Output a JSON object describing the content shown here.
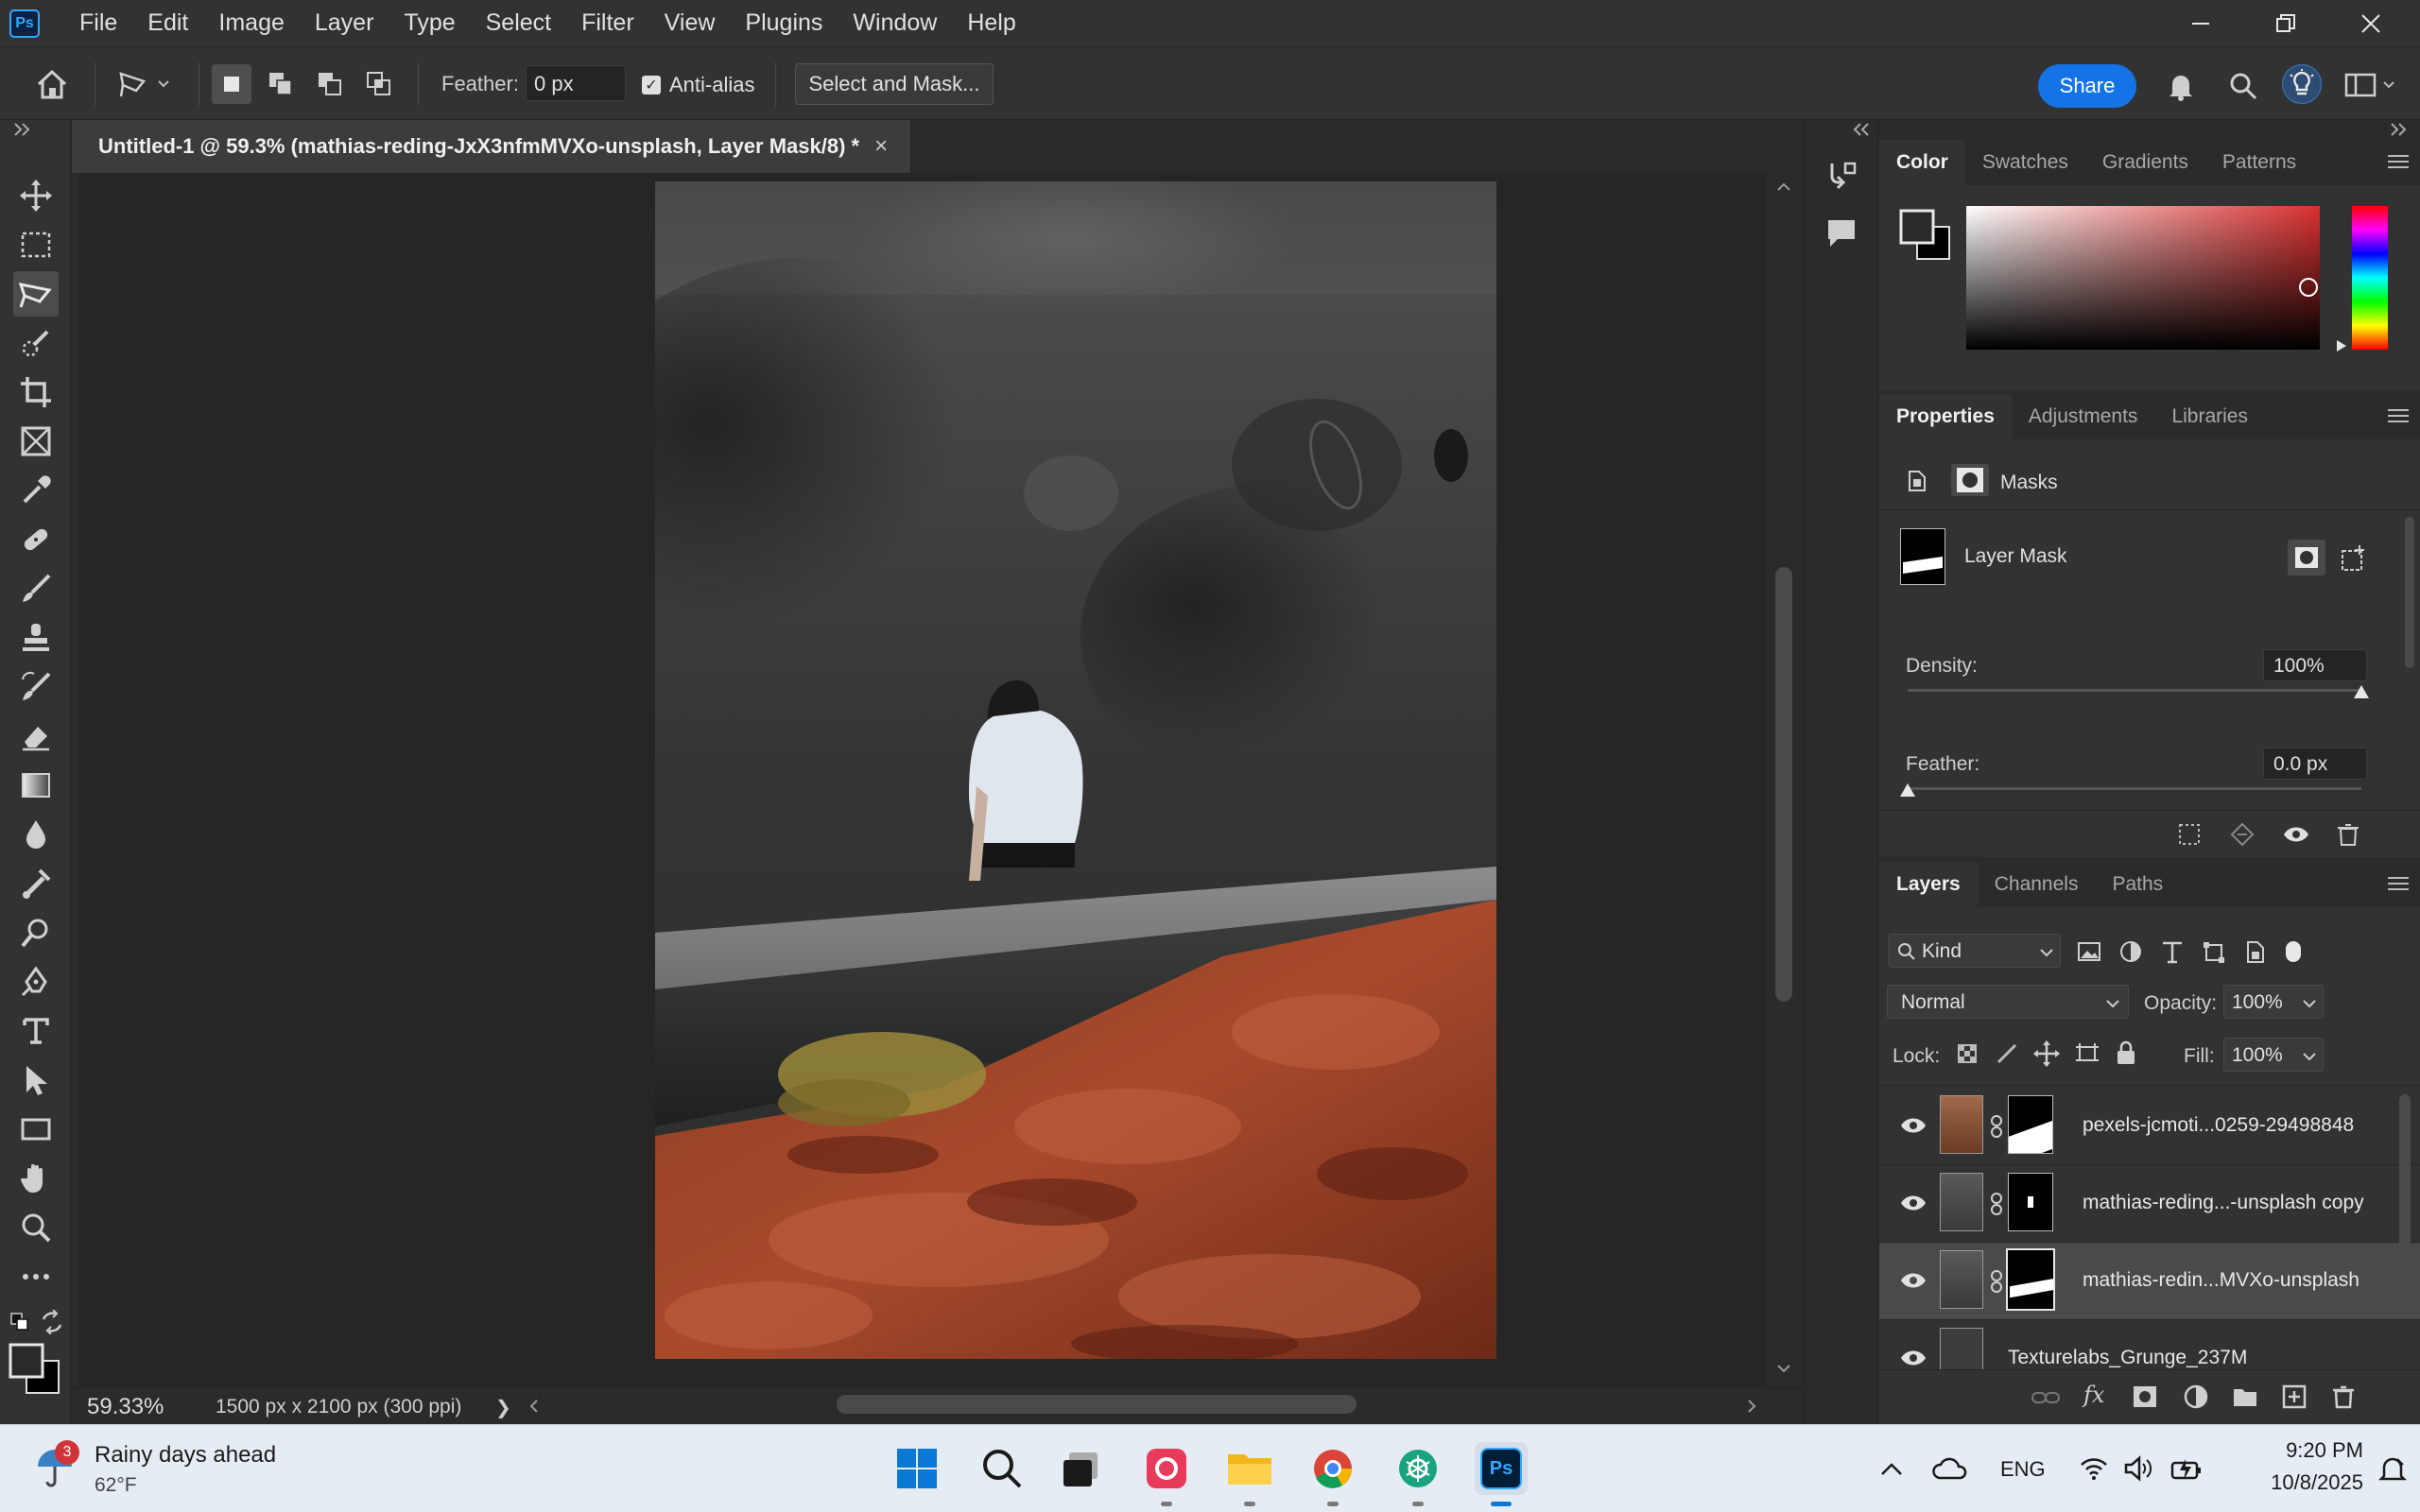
{
  "app": {
    "logo": "Ps",
    "menu": [
      "File",
      "Edit",
      "Image",
      "Layer",
      "Type",
      "Select",
      "Filter",
      "View",
      "Plugins",
      "Window",
      "Help"
    ]
  },
  "options_bar": {
    "feather_label": "Feather:",
    "feather_value": "0 px",
    "antialias_label": "Anti-alias",
    "antialias_checked": true,
    "select_mask_label": "Select and Mask...",
    "share_label": "Share"
  },
  "document": {
    "tab_title": "Untitled-1 @ 59.3% (mathias-reding-JxX3nfmMVXo-unsplash, Layer Mask/8) *",
    "close_glyph": "×",
    "zoom": "59.33%",
    "doc_size": "1500 px x 2100 px (300 ppi)",
    "status_arrow": "❯"
  },
  "color_panel": {
    "tabs": [
      "Color",
      "Swatches",
      "Gradients",
      "Patterns"
    ],
    "active_tab": "Color",
    "foreground": "#2a2a2a",
    "background": "#000000",
    "hue_color": "#d9302f"
  },
  "properties_panel": {
    "tabs": [
      "Properties",
      "Adjustments",
      "Libraries"
    ],
    "active_tab": "Properties",
    "section_label": "Masks",
    "mask_name": "Layer Mask",
    "density_label": "Density:",
    "density_value": "100%",
    "density_fraction": 1.0,
    "feather_label": "Feather:",
    "feather_value": "0.0 px",
    "feather_fraction": 0.0
  },
  "layers_panel": {
    "tabs": [
      "Layers",
      "Channels",
      "Paths"
    ],
    "active_tab": "Layers",
    "filter_label": "Kind",
    "blend_mode": "Normal",
    "opacity_label": "Opacity:",
    "opacity_value": "100%",
    "lock_label": "Lock:",
    "fill_label": "Fill:",
    "fill_value": "100%",
    "fx_label": "fx",
    "layers": [
      {
        "name": "pexels-jcmoti...0259-29498848",
        "selected": false
      },
      {
        "name": "mathias-reding...-unsplash copy",
        "selected": false
      },
      {
        "name": "mathias-redin...MVXo-unsplash",
        "selected": true
      },
      {
        "name": "Texturelabs_Grunge_237M",
        "selected": false
      }
    ]
  },
  "taskbar": {
    "weather_badge": "3",
    "weather_title": "Rainy days ahead",
    "weather_temp": "62°F",
    "language": "ENG",
    "time": "9:20 PM",
    "date": "10/8/2025",
    "ps_label": "Ps"
  }
}
